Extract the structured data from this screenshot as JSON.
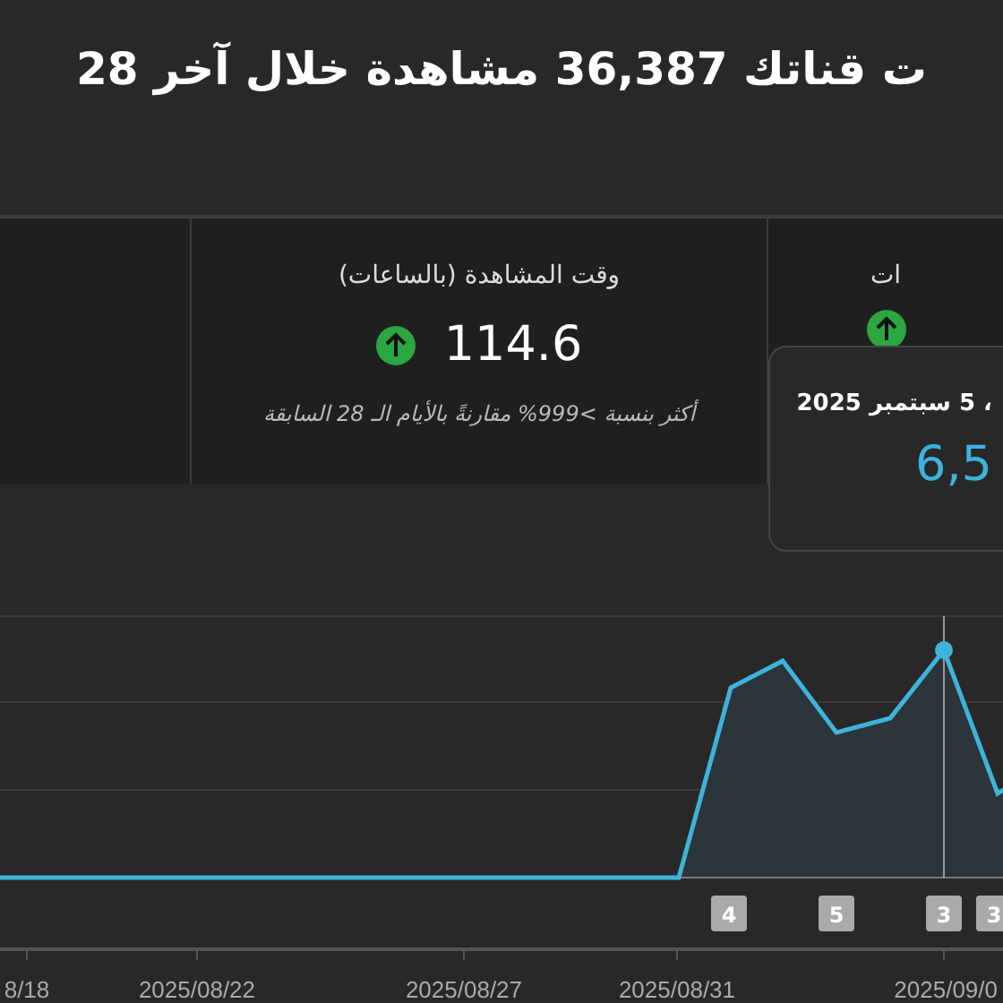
{
  "headline": "ت قناتك 36,387 مشاهدة خلال آخر 28",
  "metric_cards": [
    {
      "title": "ات",
      "increased": true
    },
    {
      "title": "وقت المشاهدة (بالساعات)",
      "value": "114.6",
      "increased": true,
      "comparison": "أكثر بنسبة >999% مقارنةً بالأيام الـ 28 السابقة"
    }
  ],
  "tooltip": {
    "date": "، 5 سبتمبر 2025",
    "value": "6,5"
  },
  "chart": {
    "markers": [
      "3",
      "3",
      "5",
      "4"
    ],
    "x_labels": [
      "2025/09/0",
      "2025/08/31",
      "2025/08/27",
      "2025/08/22",
      "8/18"
    ]
  }
}
